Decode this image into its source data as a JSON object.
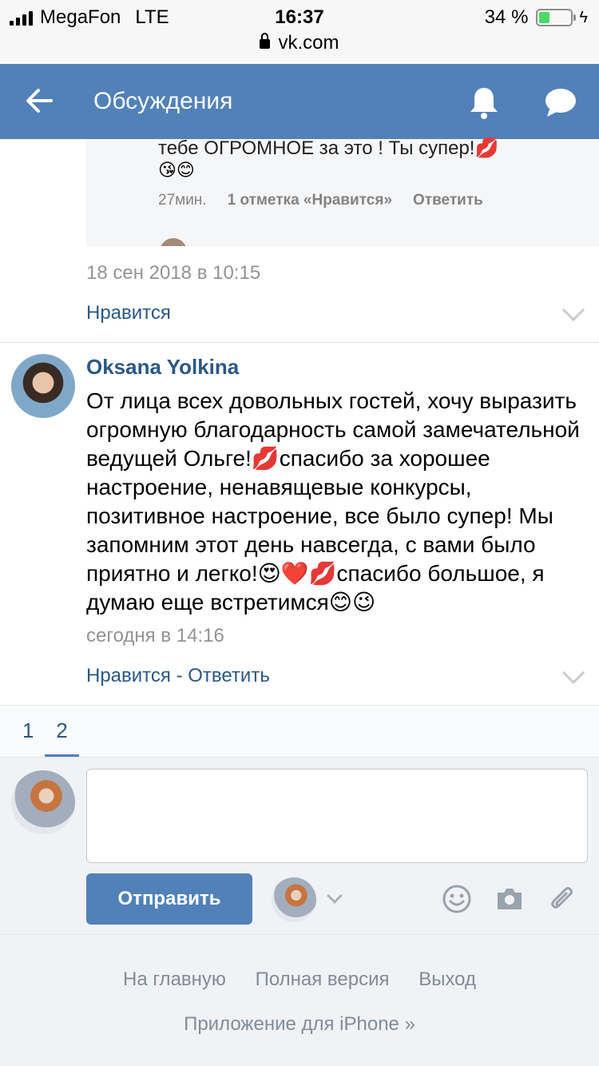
{
  "status_bar": {
    "carrier": "MegaFon",
    "network": "LTE",
    "time": "16:37",
    "url": "vk.com",
    "battery": "34 %",
    "battery_level": 0.34
  },
  "header": {
    "title": "Обсуждения",
    "accent_color": "#5181b8"
  },
  "previous_reply": {
    "text": "тебе ОГРОМНОЕ за это ! Ты супер!💋",
    "emoji": "😘😊",
    "time": "27мин.",
    "likes": "1 отметка «Нравится»",
    "reply_label": "Ответить"
  },
  "previous_post": {
    "date": "18 сен 2018 в 10:15",
    "like_label": "Нравится"
  },
  "comment": {
    "author": "Oksana Yolkina",
    "text": "От лица всех довольных гостей, хочу выразить огромную благодарность самой замечательной ведущей Ольге!💋спасибо за хорошее настроение, ненавящевые конкурсы, позитивное настроение, все было супер! Мы запомним этот день навсегда, с вами было приятно и легко!😍❤️💋спасибо большое, я думаю еще встретимся😊😉",
    "date": "сегодня в 14:16",
    "like_label": "Нравится",
    "separator": " - ",
    "reply_label": "Ответить"
  },
  "pagination": {
    "pages": [
      "1",
      "2"
    ],
    "active": "2"
  },
  "compose": {
    "send_label": "Отправить",
    "icons": [
      "smile-icon",
      "camera-icon",
      "paperclip-icon"
    ]
  },
  "footer": {
    "home": "На главную",
    "full_version": "Полная версия",
    "logout": "Выход",
    "app": "Приложение для iPhone »"
  }
}
